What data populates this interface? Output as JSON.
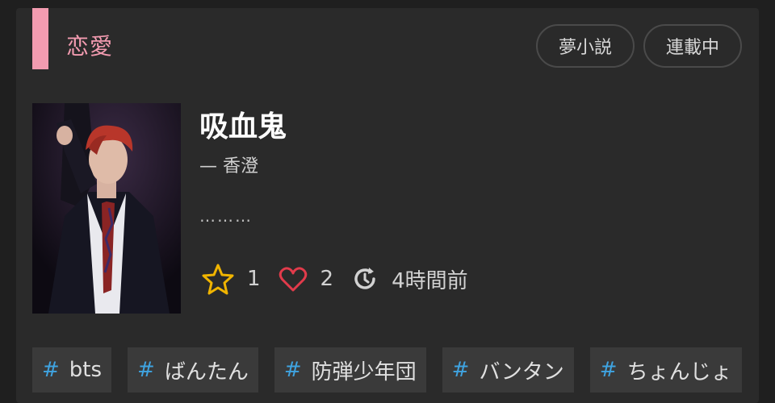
{
  "genre": {
    "label": "恋愛",
    "color": "#f29bb0"
  },
  "badges": {
    "type": "夢小説",
    "status": "連載中"
  },
  "story": {
    "title": "吸血鬼",
    "author": "— 香澄",
    "summary": "………"
  },
  "stats": {
    "stars": "1",
    "hearts": "2",
    "updated": "4時間前",
    "star_icon": "star-icon",
    "heart_icon": "heart-icon",
    "update_icon": "refresh-clock-icon"
  },
  "tags": [
    {
      "hash": "#",
      "label": "bts"
    },
    {
      "hash": "#",
      "label": "ばんたん"
    },
    {
      "hash": "#",
      "label": "防弾少年団"
    },
    {
      "hash": "#",
      "label": "バンタン"
    },
    {
      "hash": "#",
      "label": "ちょんじょ"
    }
  ],
  "colors": {
    "accent": "#f29bb0",
    "star": "#f0b400",
    "heart": "#e23b4b",
    "tag_hash": "#3fa3e0"
  }
}
